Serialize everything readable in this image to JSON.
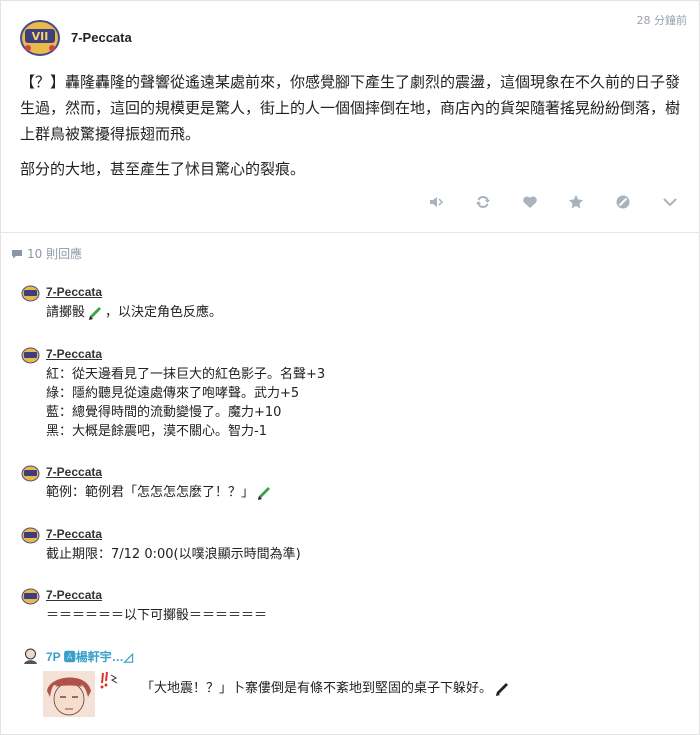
{
  "post": {
    "author": "7-Peccata",
    "time": "28 分鐘前",
    "paragraphs": [
      "【？】轟隆轟隆的聲響從遙遠某處前來，你感覺腳下產生了劇烈的震盪，這個現象在不久前的日子發生過，然而，這回的規模更是驚人，街上的人一個個摔倒在地，商店內的貨架隨著搖晃紛紛倒落，樹上群鳥被驚擾得振翅而飛。",
      "部分的大地，甚至產生了怵目驚心的裂痕。"
    ]
  },
  "actions": [
    "speaker-icon",
    "repost-icon",
    "heart-icon",
    "star-icon",
    "block-icon",
    "chevron-down-icon"
  ],
  "reply_count": "10 則回應",
  "comments": [
    {
      "author": "7-Peccata",
      "lines": [
        "請擲骰",
        "，以決定角色反應。"
      ]
    },
    {
      "author": "7-Peccata",
      "lines": [
        "紅：從天邊看見了一抹巨大的紅色影子。名聲+3",
        "綠：隱約聽見從遠處傳來了咆哮聲。武力+5",
        "藍：總覺得時間的流動變慢了。魔力+10",
        "黑：大概是餘震吧，漠不關心。智力-1"
      ]
    },
    {
      "author": "7-Peccata",
      "lines": [
        "範例：範例君「怎怎怎怎麼了！？」"
      ]
    },
    {
      "author": "7-Peccata",
      "lines": [
        "截止期限：7/12 0:00(以噗浪顯示時間為準)"
      ]
    },
    {
      "author": "7-Peccata",
      "lines": [
        "＝＝＝＝＝＝以下可擲骰＝＝＝＝＝＝"
      ]
    }
  ],
  "last_comment": {
    "author": "7P 🅰楊軒宇…◿",
    "text": "「大地震！？」卜寨僂倒是有條不紊地到堅固的桌子下躲好。"
  }
}
